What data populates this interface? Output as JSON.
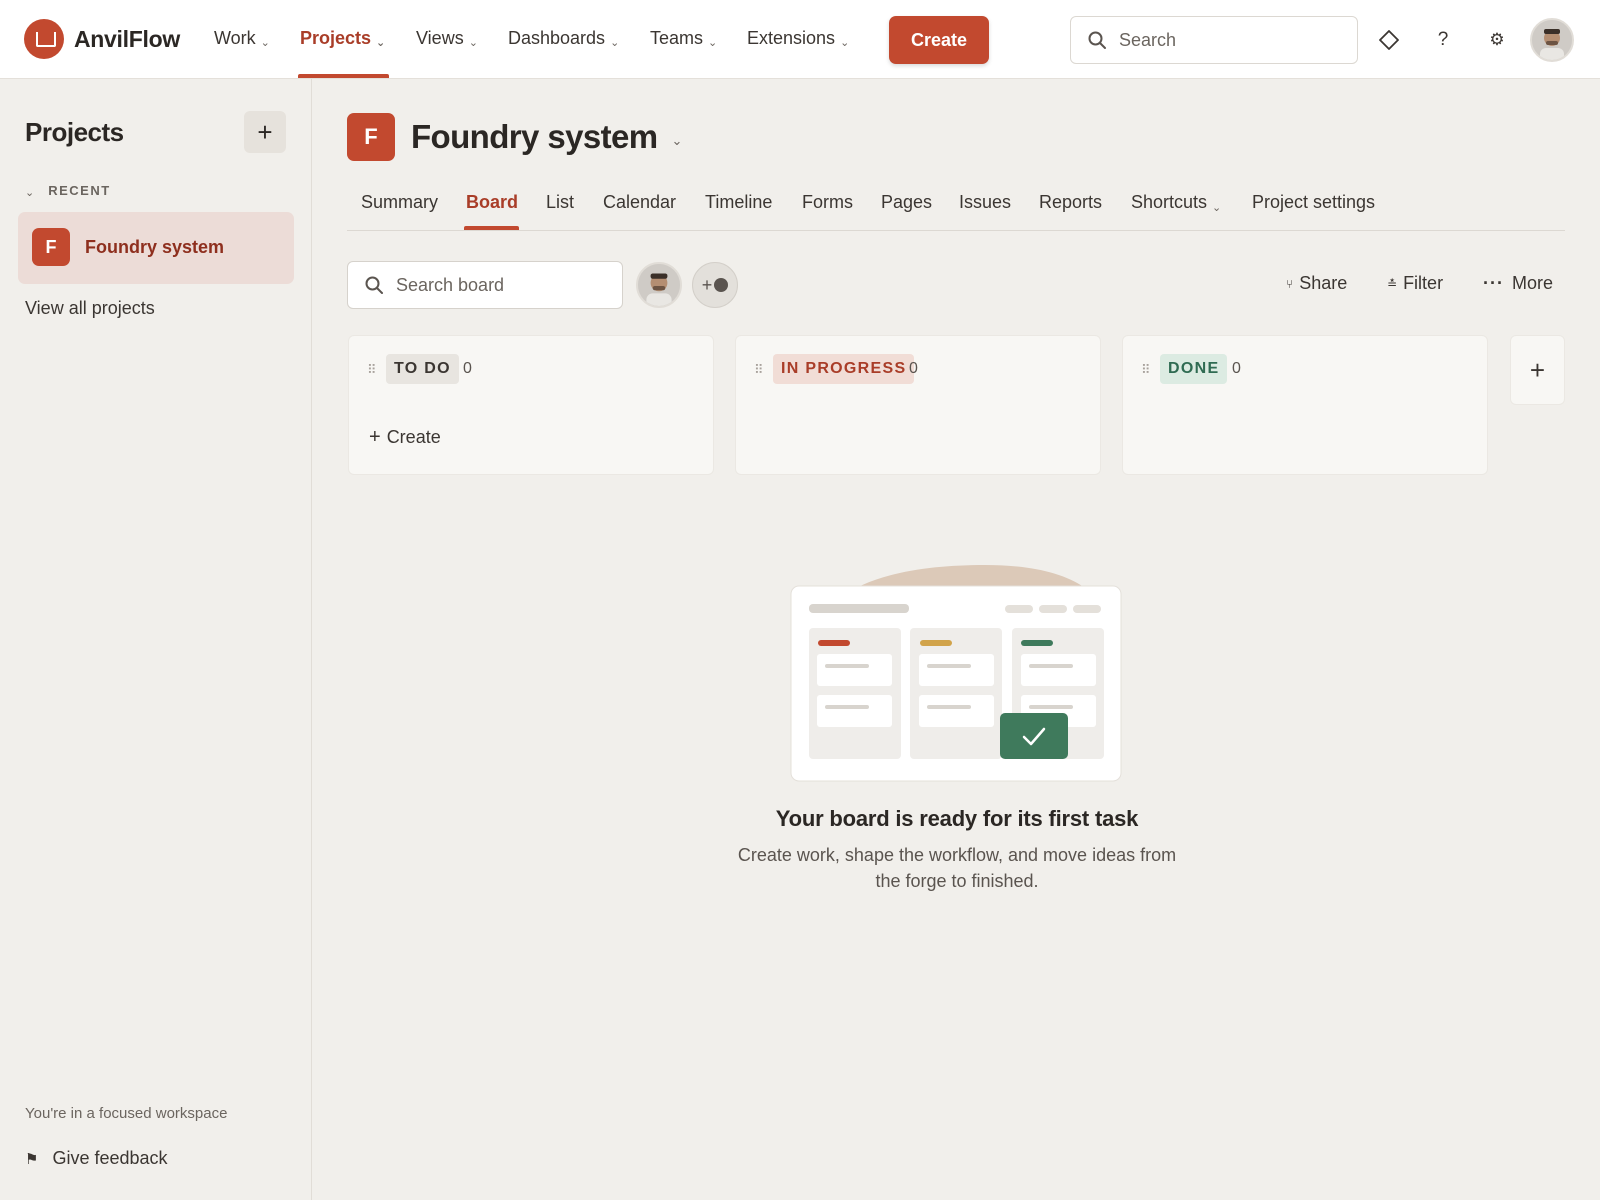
{
  "app": {
    "name": "AnvilFlow",
    "brand_color": "#c2492f",
    "logo_icon": "anvil-logo-icon"
  },
  "topnav": {
    "items": [
      {
        "label": "Work",
        "has_dropdown": true,
        "active": false
      },
      {
        "label": "Projects",
        "has_dropdown": true,
        "active": true
      },
      {
        "label": "Views",
        "has_dropdown": true,
        "active": false
      },
      {
        "label": "Dashboards",
        "has_dropdown": true,
        "active": false
      },
      {
        "label": "Teams",
        "has_dropdown": true,
        "active": false
      },
      {
        "label": "Extensions",
        "has_dropdown": true,
        "active": false
      }
    ],
    "create_label": "Create",
    "search_placeholder": "Search",
    "icons": [
      "diamond-icon",
      "help-icon",
      "settings-icon",
      "user-avatar"
    ]
  },
  "sidebar": {
    "title": "Projects",
    "add_icon": "plus-icon",
    "recent_label": "RECENT",
    "recent_projects": [
      {
        "initial": "F",
        "name": "Foundry system",
        "selected": true
      }
    ],
    "view_all_label": "View all projects",
    "workspace_note": "You're in a focused workspace",
    "feedback_label": "Give feedback"
  },
  "project": {
    "initial": "F",
    "name": "Foundry system",
    "tabs": [
      {
        "label": "Summary",
        "active": false
      },
      {
        "label": "Board",
        "active": true
      },
      {
        "label": "List",
        "active": false
      },
      {
        "label": "Calendar",
        "active": false
      },
      {
        "label": "Timeline",
        "active": false
      },
      {
        "label": "Forms",
        "active": false
      },
      {
        "label": "Pages",
        "active": false
      },
      {
        "label": "Issues",
        "active": false
      },
      {
        "label": "Reports",
        "active": false
      },
      {
        "label": "Shortcuts",
        "active": false,
        "has_dropdown": true
      },
      {
        "label": "Project settings",
        "active": false
      }
    ]
  },
  "board": {
    "search_placeholder": "Search board",
    "add_people_label": "+",
    "actions": {
      "share": "Share",
      "filter": "Filter",
      "more": "More"
    },
    "columns": [
      {
        "status": "TO DO",
        "count": "0",
        "color": "#3b3632",
        "bg": "#e8e5e0",
        "show_create": true,
        "create_label": "Create"
      },
      {
        "status": "IN PROGRESS",
        "count": "0",
        "color": "#a93d28",
        "bg": "#f1ddd6",
        "show_create": false
      },
      {
        "status": "DONE",
        "count": "0",
        "color": "#2f6b52",
        "bg": "#dcebe2",
        "show_create": false
      }
    ],
    "empty_state": {
      "title": "Your board is ready for its first task",
      "description": "Create work, shape the workflow, and move ideas from the forge to finished."
    }
  }
}
